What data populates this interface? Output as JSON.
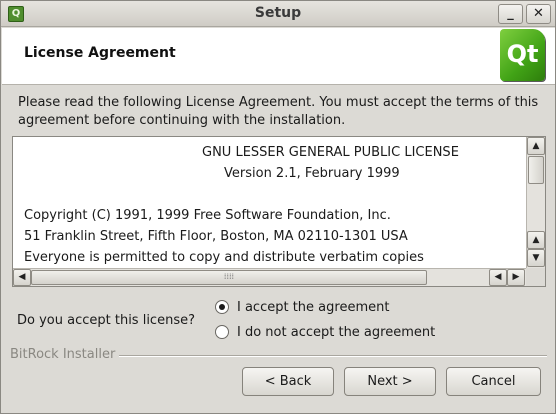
{
  "window": {
    "title": "Setup",
    "app_icon": "Q",
    "minimize_label": "_",
    "close_label": "✕"
  },
  "header": {
    "title": "License Agreement",
    "logo_text": "Qt"
  },
  "intro": "Please read the following License Agreement. You must accept the terms of this agreement before continuing with the installation.",
  "license": {
    "lines": [
      "GNU LESSER GENERAL PUBLIC LICENSE",
      "Version 2.1, February 1999",
      "",
      "Copyright (C) 1991, 1999 Free Software Foundation, Inc.",
      "51 Franklin Street, Fifth Floor, Boston, MA  02110-1301  USA",
      "Everyone is permitted to copy and distribute verbatim copies"
    ]
  },
  "scrollbar": {
    "up_arrow": "▲",
    "down_arrow": "▼",
    "left_arrow": "◀",
    "right_arrow": "▶",
    "grip": "⁞⁞⁞⁞"
  },
  "accept": {
    "question": "Do you accept this license?",
    "options": [
      {
        "label": "I accept the agreement",
        "selected": true
      },
      {
        "label": "I do not accept the agreement",
        "selected": false
      }
    ]
  },
  "footer": {
    "brand": "BitRock Installer",
    "back_label": "< Back",
    "next_label": "Next >",
    "cancel_label": "Cancel"
  }
}
